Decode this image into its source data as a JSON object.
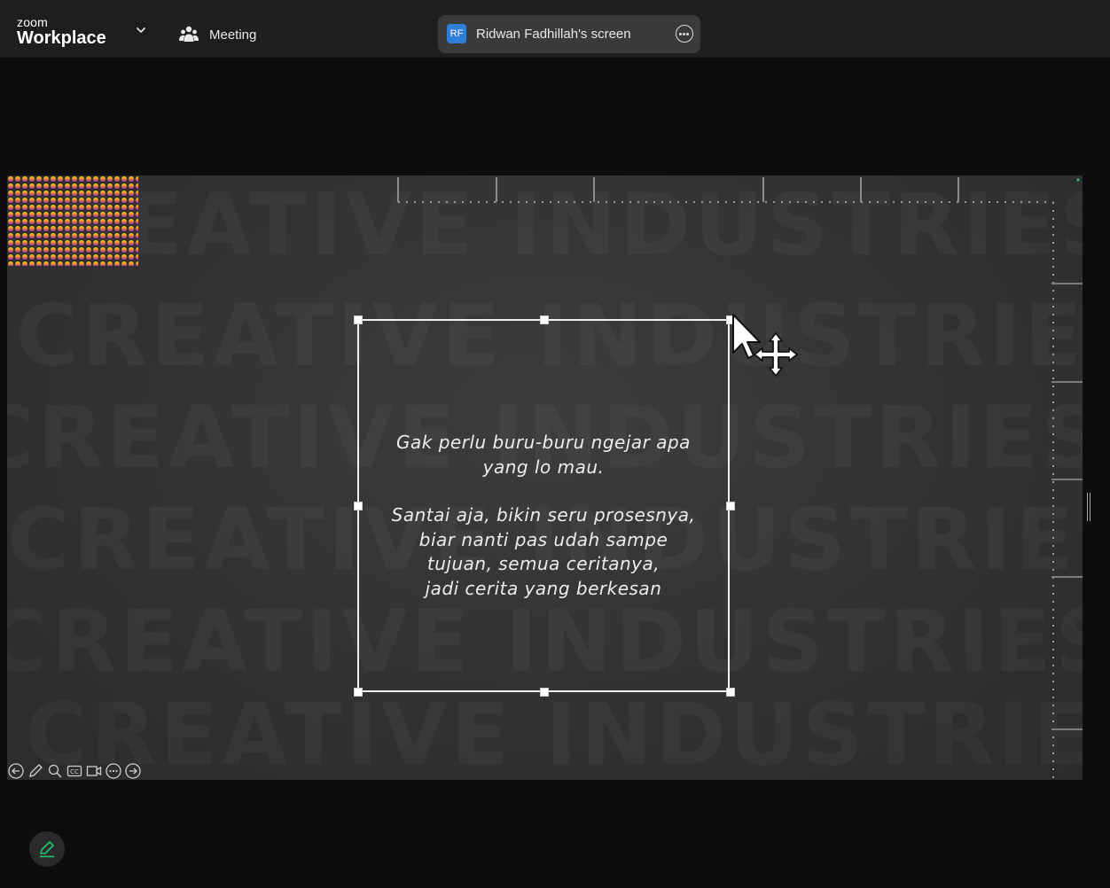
{
  "topbar": {
    "brand_small": "zoom",
    "brand_large": "Workplace",
    "meeting_label": "Meeting",
    "screen_share": {
      "avatar_initials": "RF",
      "label": "Ridwan Fadhillah's screen"
    }
  },
  "shared_screen": {
    "quote_lines_1": [
      "Gak perlu buru-buru ngejar apa",
      "yang lo mau."
    ],
    "quote_lines_2": [
      "Santai aja, bikin seru prosesnya,",
      "biar nanti pas udah sampe",
      "tujuan, semua ceritanya,",
      "jadi cerita yang berkesan"
    ],
    "watermark_text": "CREATIVE INDUSTRIES",
    "slide_controls": [
      "prev-arrow-icon",
      "pen-icon",
      "zoom-icon",
      "cc-icon",
      "video-icon",
      "more-icon",
      "next-arrow-icon"
    ]
  },
  "colors": {
    "topbar_bg": "#1e1e1e",
    "page_bg": "#0d0d0d",
    "pill_bg": "#3a3a3a",
    "avatar_bg": "#2f7ed8",
    "annotate_icon": "#1fc56c"
  }
}
